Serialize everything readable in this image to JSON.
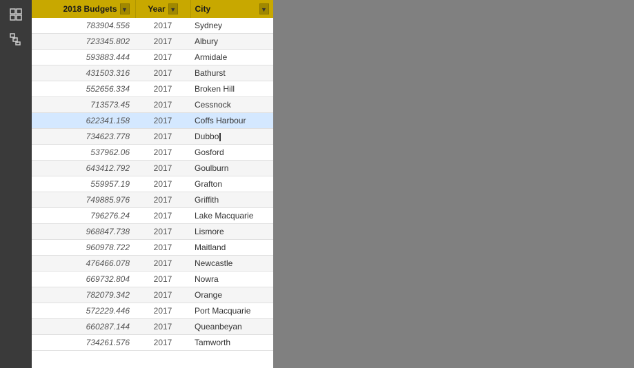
{
  "leftPanel": {
    "icons": [
      {
        "name": "grid-icon",
        "symbol": "⊞"
      },
      {
        "name": "hierarchy-icon",
        "symbol": "⊟"
      }
    ]
  },
  "table": {
    "columns": [
      {
        "key": "budgets",
        "label": "2018 Budgets",
        "hasDropdown": true
      },
      {
        "key": "year",
        "label": "Year",
        "hasDropdown": true
      },
      {
        "key": "city",
        "label": "City",
        "hasDropdown": true
      }
    ],
    "rows": [
      {
        "budget": "783904.556",
        "year": "2017",
        "city": "Sydney",
        "highlight": false
      },
      {
        "budget": "723345.802",
        "year": "2017",
        "city": "Albury",
        "highlight": false
      },
      {
        "budget": "593883.444",
        "year": "2017",
        "city": "Armidale",
        "highlight": false
      },
      {
        "budget": "431503.316",
        "year": "2017",
        "city": "Bathurst",
        "highlight": false
      },
      {
        "budget": "552656.334",
        "year": "2017",
        "city": "Broken Hill",
        "highlight": false
      },
      {
        "budget": "713573.45",
        "year": "2017",
        "city": "Cessnock",
        "highlight": false
      },
      {
        "budget": "622341.158",
        "year": "2017",
        "city": "Coffs Harbour",
        "highlight": true
      },
      {
        "budget": "734623.778",
        "year": "2017",
        "city": "Dubbo",
        "highlight": false,
        "cursor": true
      },
      {
        "budget": "537962.06",
        "year": "2017",
        "city": "Gosford",
        "highlight": false
      },
      {
        "budget": "643412.792",
        "year": "2017",
        "city": "Goulburn",
        "highlight": false
      },
      {
        "budget": "559957.19",
        "year": "2017",
        "city": "Grafton",
        "highlight": false
      },
      {
        "budget": "749885.976",
        "year": "2017",
        "city": "Griffith",
        "highlight": false
      },
      {
        "budget": "796276.24",
        "year": "2017",
        "city": "Lake Macquarie",
        "highlight": false
      },
      {
        "budget": "968847.738",
        "year": "2017",
        "city": "Lismore",
        "highlight": false
      },
      {
        "budget": "960978.722",
        "year": "2017",
        "city": "Maitland",
        "highlight": false
      },
      {
        "budget": "476466.078",
        "year": "2017",
        "city": "Newcastle",
        "highlight": false
      },
      {
        "budget": "669732.804",
        "year": "2017",
        "city": "Nowra",
        "highlight": false
      },
      {
        "budget": "782079.342",
        "year": "2017",
        "city": "Orange",
        "highlight": false
      },
      {
        "budget": "572229.446",
        "year": "2017",
        "city": "Port Macquarie",
        "highlight": false
      },
      {
        "budget": "660287.144",
        "year": "2017",
        "city": "Queanbeyan",
        "highlight": false
      },
      {
        "budget": "734261.576",
        "year": "2017",
        "city": "Tamworth",
        "highlight": false
      }
    ]
  }
}
